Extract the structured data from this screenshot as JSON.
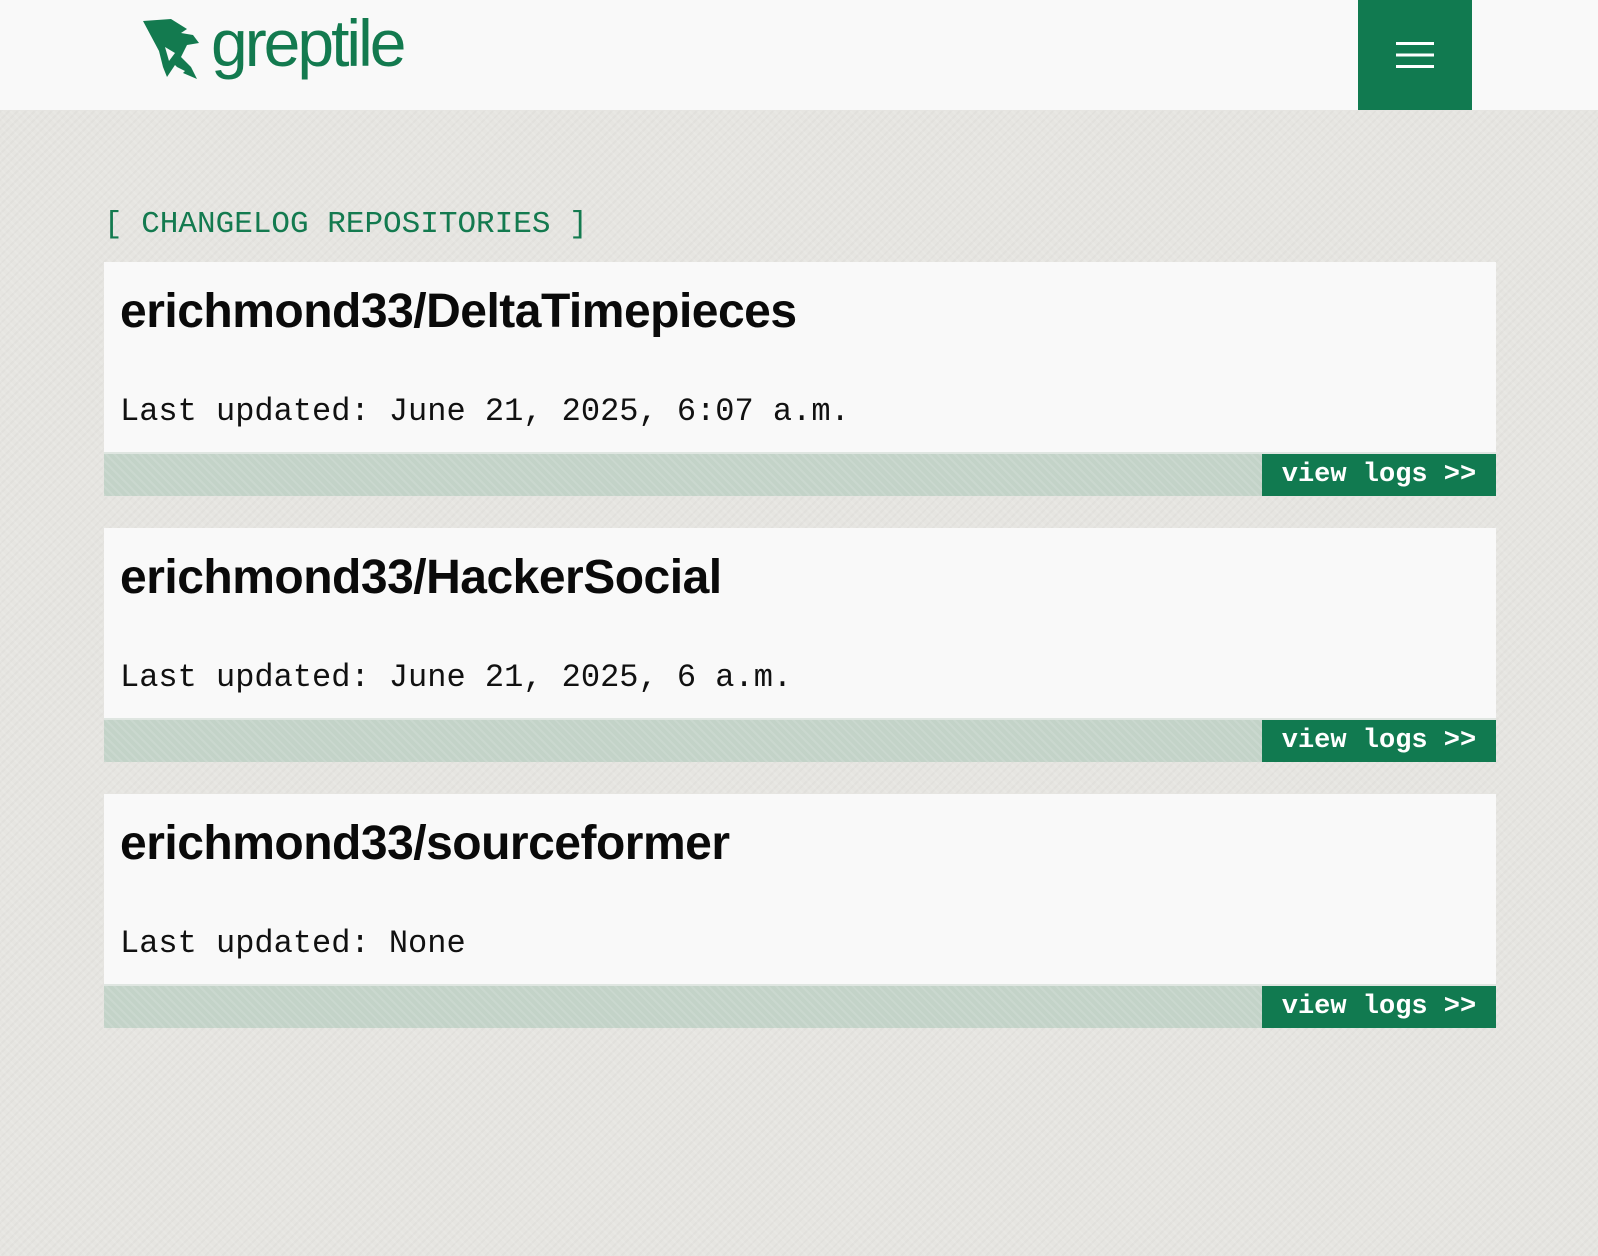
{
  "brand": {
    "name": "greptile",
    "color": "#137a4f"
  },
  "header": {
    "menu_icon": "hamburger-menu-icon"
  },
  "section": {
    "heading": "[ CHANGELOG REPOSITORIES ]"
  },
  "repos": [
    {
      "name": "erichmond33/DeltaTimepieces",
      "last_updated": "Last updated: June 21, 2025, 6:07 a.m.",
      "link_label": "view logs >>"
    },
    {
      "name": "erichmond33/HackerSocial",
      "last_updated": "Last updated: June 21, 2025, 6 a.m.",
      "link_label": "view logs >>"
    },
    {
      "name": "erichmond33/sourceformer",
      "last_updated": "Last updated: None",
      "link_label": "view logs >>"
    }
  ],
  "colors": {
    "accent": "#117a50",
    "page_background": "#e6e5e1",
    "card_background": "#f9f9f9",
    "footer_strip": "#c3d3c8"
  }
}
